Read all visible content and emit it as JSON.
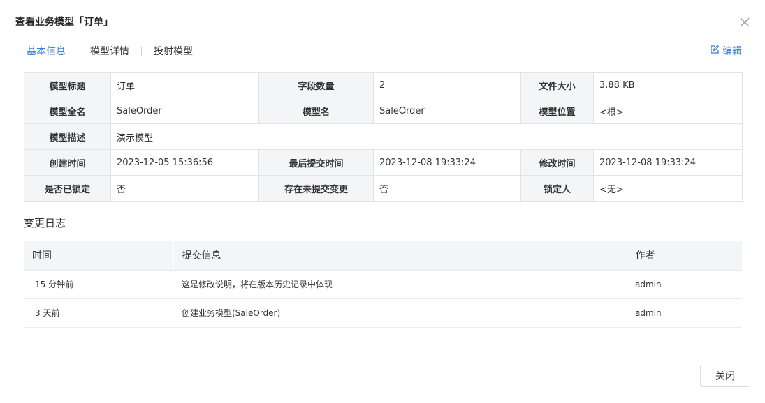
{
  "dialog": {
    "title": "查看业务模型「订单」",
    "close_icon": "close-icon"
  },
  "tabs": [
    {
      "label": "基本信息",
      "active": true
    },
    {
      "label": "模型详情",
      "active": false
    },
    {
      "label": "投射模型",
      "active": false
    }
  ],
  "edit": {
    "label": "编辑",
    "icon": "edit-icon"
  },
  "info": {
    "model_title_label": "模型标题",
    "model_title": "订单",
    "field_count_label": "字段数量",
    "field_count": "2",
    "file_size_label": "文件大小",
    "file_size": "3.88 KB",
    "full_name_label": "模型全名",
    "full_name": "SaleOrder",
    "model_name_label": "模型名",
    "model_name": "SaleOrder",
    "location_label": "模型位置",
    "location": "<根>",
    "description_label": "模型描述",
    "description": "演示模型",
    "created_label": "创建时间",
    "created": "2023-12-05 15:36:56",
    "last_commit_label": "最后提交时间",
    "last_commit": "2023-12-08 19:33:24",
    "modified_label": "修改时间",
    "modified": "2023-12-08 19:33:24",
    "locked_label": "是否已锁定",
    "locked": "否",
    "uncommitted_label": "存在未提交变更",
    "uncommitted": "否",
    "locker_label": "锁定人",
    "locker": "<无>"
  },
  "changelog": {
    "title": "变更日志",
    "headers": {
      "time": "时间",
      "message": "提交信息",
      "author": "作者"
    },
    "rows": [
      {
        "time": "15 分钟前",
        "message": "这是修改说明，将在版本历史记录中体现",
        "author": "admin"
      },
      {
        "time": "3 天前",
        "message": "创建业务模型(SaleOrder)",
        "author": "admin"
      }
    ]
  },
  "footer": {
    "close_label": "关闭"
  },
  "colors": {
    "accent": "#3a7bd5",
    "label_bg": "#f4f5f7",
    "border": "#e3e3e3"
  }
}
